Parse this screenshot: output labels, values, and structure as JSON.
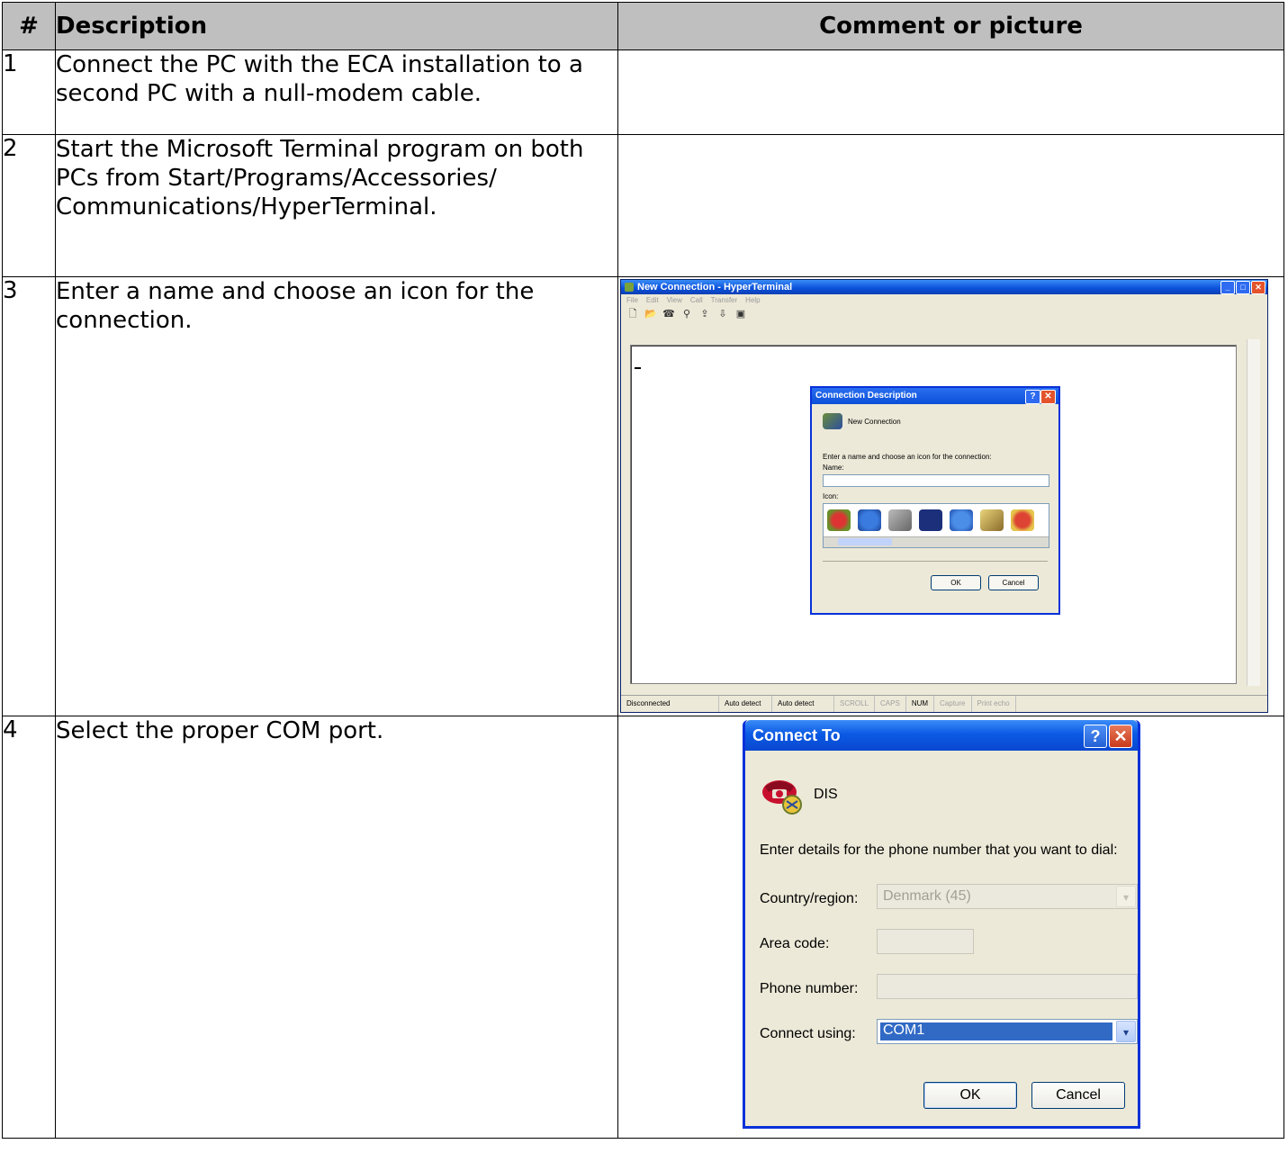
{
  "table": {
    "headers": {
      "num": "#",
      "description": "Description",
      "comment": "Comment or picture"
    },
    "rows": [
      {
        "num": "1",
        "description": "Connect the PC with the ECA installation to a second PC with a null-modem cable."
      },
      {
        "num": "2",
        "description": "Start the Microsoft Terminal program on both PCs from Start/Programs/Accessories/ Communications/HyperTerminal."
      },
      {
        "num": "3",
        "description": "Enter a name and choose an icon for the connection."
      },
      {
        "num": "4",
        "description": "Select the proper COM port."
      }
    ]
  },
  "hyperterminal": {
    "title": "New Connection - HyperTerminal",
    "menu": [
      "File",
      "Edit",
      "View",
      "Call",
      "Transfer",
      "Help"
    ],
    "status": [
      "Disconnected",
      "Auto detect",
      "Auto detect",
      "SCROLL",
      "CAPS",
      "NUM",
      "Capture",
      "Print echo"
    ],
    "dialog": {
      "title": "Connection Description",
      "connection_name": "New Connection",
      "prompt": "Enter a name and choose an icon for the connection:",
      "name_label": "Name:",
      "name_value": "",
      "icon_label": "Icon:",
      "ok": "OK",
      "cancel": "Cancel"
    }
  },
  "connect_to": {
    "title": "Connect To",
    "help_glyph": "?",
    "close_glyph": "✕",
    "connection_name": "DIS",
    "prompt": "Enter details for the phone number that you want to dial:",
    "country_label": "Country/region:",
    "country_value": "Denmark (45)",
    "area_label": "Area code:",
    "area_value": "",
    "phone_label": "Phone number:",
    "phone_value": "",
    "connect_label": "Connect using:",
    "connect_value": "COM1",
    "ok": "OK",
    "cancel": "Cancel"
  },
  "colors": {
    "header_bg": "#bfbfbf",
    "xp_title_blue": "#0a4fd8",
    "xp_close_red": "#e4542c",
    "selection_blue": "#316ac5"
  }
}
